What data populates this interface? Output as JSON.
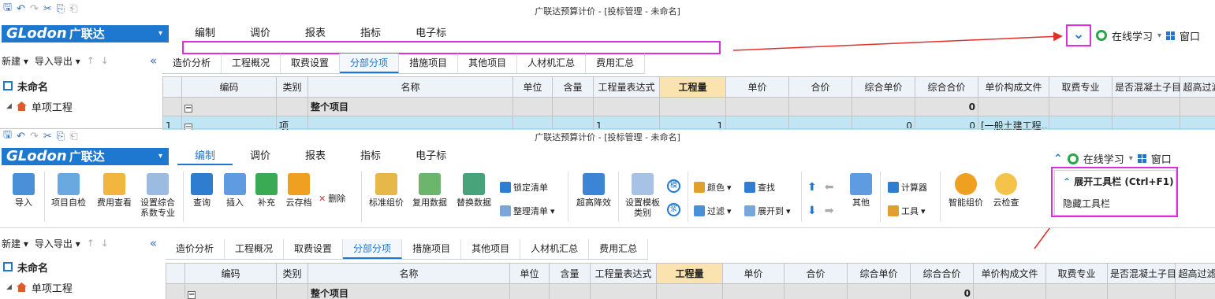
{
  "window": {
    "title": "广联达预算计价 - [投标管理 - 未命名]"
  },
  "logo": {
    "en": "GLodon",
    "cn": "广联达",
    "arrow": "▾"
  },
  "menu": [
    "编制",
    "调价",
    "报表",
    "指标",
    "电子标"
  ],
  "rightbar": {
    "collapse_chevron": "⌄",
    "expand_chevron": "⌃",
    "online_learning": "在线学习",
    "window": "窗口",
    "caret": "▾"
  },
  "sidebar": {
    "new": "新建",
    "import_export": "导入导出",
    "up": "↑",
    "down": "↓",
    "collapse": "«",
    "root": "未命名",
    "child": "单项工程"
  },
  "tabs": [
    "造价分析",
    "工程概况",
    "取费设置",
    "分部分项",
    "措施项目",
    "其他项目",
    "人材机汇总",
    "费用汇总"
  ],
  "table": {
    "headers": [
      "编码",
      "类别",
      "名称",
      "单位",
      "含量",
      "工程量表达式",
      "工程量",
      "单价",
      "合价",
      "综合单价",
      "综合合价",
      "单价构成文件",
      "取费专业",
      "是否混凝土子目",
      "超高过滤类别"
    ],
    "summary_row": {
      "name": "整个项目",
      "total": "0"
    },
    "row1": {
      "index": "1",
      "type": "项",
      "expr": "1",
      "qty": "1",
      "unit_total": "0",
      "total": "0",
      "file": "[一般土建工程…"
    }
  },
  "ribbon": {
    "large": [
      "导入",
      "项目自检",
      "费用查看",
      "设置综合\n系数专业",
      "查询",
      "插入",
      "补充",
      "云存档",
      "标准组价",
      "复用数据",
      "替换数据",
      "超高降效",
      "设置模板\n类别",
      "其他",
      "智能组价",
      "云检查"
    ],
    "delete": "删除",
    "lock": "锁定清单",
    "tidy": "整理清单",
    "circle1": "模",
    "circle2": "浆",
    "color": "颜色",
    "find": "查找",
    "filter": "过滤",
    "expand_to": "展开到",
    "calc": "计算器",
    "tools": "工具"
  },
  "dropdown": {
    "expand": "展开工具栏 (Ctrl+F1)",
    "hide": "隐藏工具栏"
  },
  "colors": {
    "brand": "#1e78d0",
    "annotation": "#e02be0",
    "arrow": "#e0302a"
  }
}
